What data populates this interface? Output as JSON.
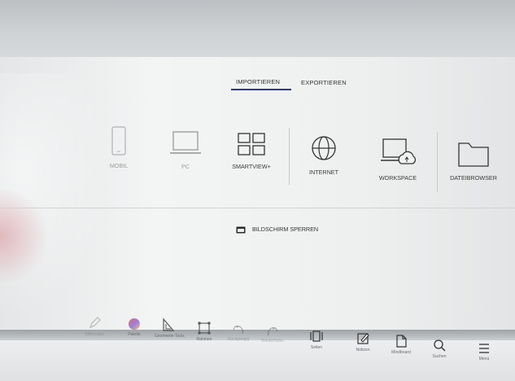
{
  "tabs": {
    "import": "IMPORTIEREN",
    "export": "EXPORTIEREN"
  },
  "sources": [
    {
      "label": "MOBIL",
      "icon": "phone-icon"
    },
    {
      "label": "PC",
      "icon": "laptop-icon"
    },
    {
      "label": "SMARTVIEW+",
      "icon": "grid-icon"
    },
    {
      "label": "INTERNET",
      "icon": "globe-icon"
    },
    {
      "label": "WORKSPACE",
      "icon": "cloud-laptop-icon"
    },
    {
      "label": "DATEIBROWSER",
      "icon": "folder-icon"
    }
  ],
  "lock_screen": {
    "label": "BILDSCHIRM SPERREN",
    "icon": "lock-screen-icon"
  },
  "toolbar": [
    {
      "label": "Stiftmodus",
      "icon": "pen-icon"
    },
    {
      "label": "Palette",
      "icon": "palette-icon"
    },
    {
      "label": "Geometrie-Tools",
      "icon": "geometry-icon"
    },
    {
      "label": "Rahmen",
      "icon": "frame-icon"
    },
    {
      "label": "Rückgängig",
      "icon": "undo-icon"
    },
    {
      "label": "Wiederholen",
      "icon": "redo-icon"
    },
    {
      "label": "Seiten",
      "icon": "pages-icon"
    },
    {
      "label": "Notizen",
      "icon": "note-icon"
    },
    {
      "label": "Mindboard",
      "icon": "document-icon"
    },
    {
      "label": "Suchen",
      "icon": "search-icon"
    },
    {
      "label": "Menü",
      "icon": "menu-icon"
    }
  ],
  "colors": {
    "accent": "#2e3b8a"
  }
}
